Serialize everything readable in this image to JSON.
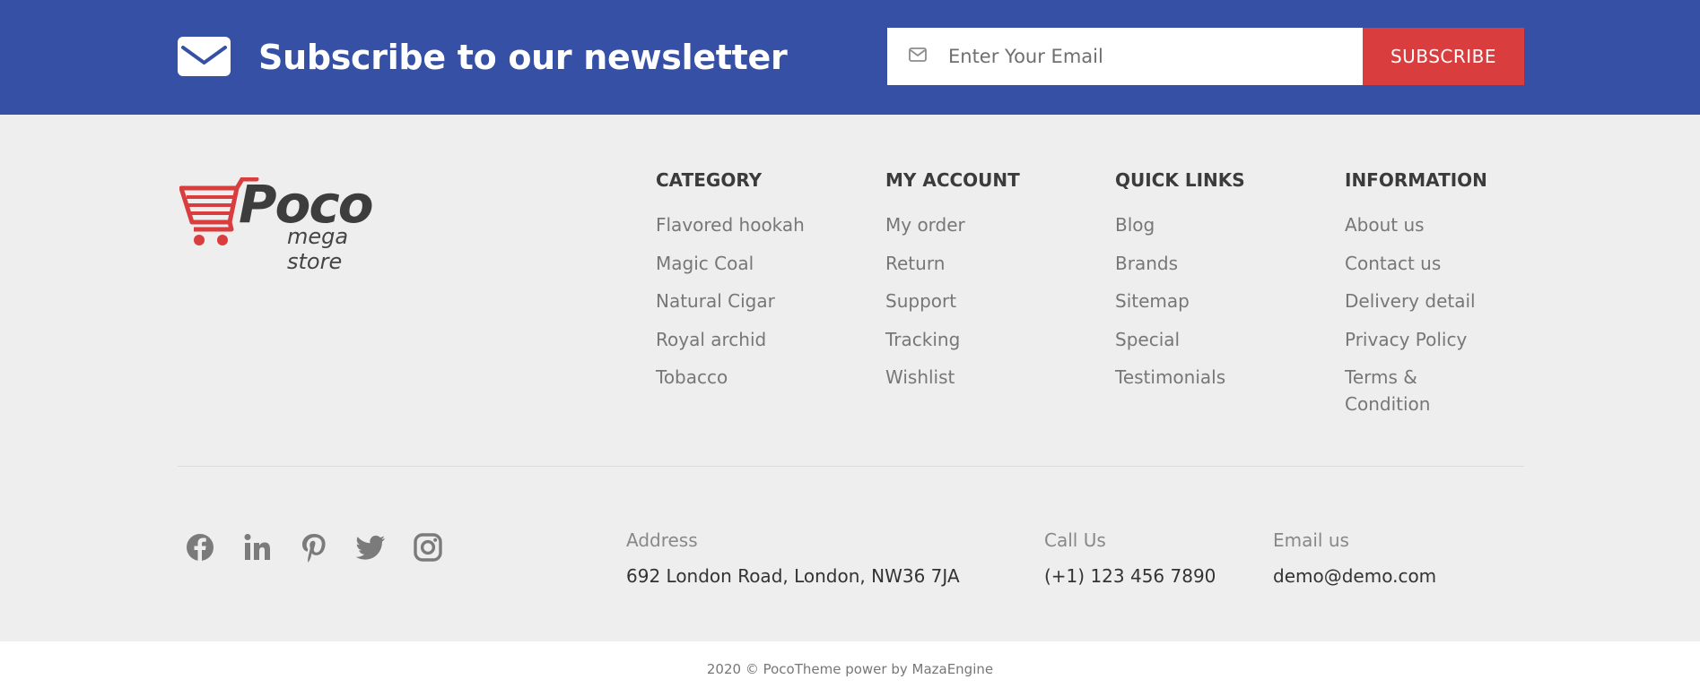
{
  "newsletter": {
    "title": "Subscribe to our newsletter",
    "email_placeholder": "Enter Your Email",
    "subscribe_label": "SUBSCRIBE",
    "background_color": "#3650a5",
    "button_color": "#d93d3e",
    "icon": "envelope-icon"
  },
  "logo": {
    "name": "Poco",
    "tagline": "mega store",
    "icon": "shopping-cart-icon"
  },
  "columns": [
    {
      "title": "CATEGORY",
      "items": [
        "Flavored hookah",
        "Magic Coal",
        "Natural Cigar",
        "Royal archid",
        "Tobacco"
      ]
    },
    {
      "title": "MY ACCOUNT",
      "items": [
        "My order",
        "Return",
        "Support",
        "Tracking",
        "Wishlist"
      ]
    },
    {
      "title": "QUICK LINKS",
      "items": [
        "Blog",
        "Brands",
        "Sitemap",
        "Special",
        "Testimonials"
      ]
    },
    {
      "title": "INFORMATION",
      "items": [
        "About us",
        "Contact us",
        "Delivery detail",
        "Privacy Policy",
        "Terms & Condition"
      ]
    }
  ],
  "social_icons": [
    "facebook-icon",
    "linkedin-icon",
    "pinterest-icon",
    "twitter-icon",
    "instagram-icon"
  ],
  "contact": {
    "address_label": "Address",
    "address_value": "692 London Road, London, NW36 7JA",
    "call_label": "Call Us",
    "call_value": "(+1) 123 456 7890",
    "email_label": "Email us",
    "email_value": "demo@demo.com"
  },
  "copyright": "2020 © PocoTheme power by MazaEngine"
}
